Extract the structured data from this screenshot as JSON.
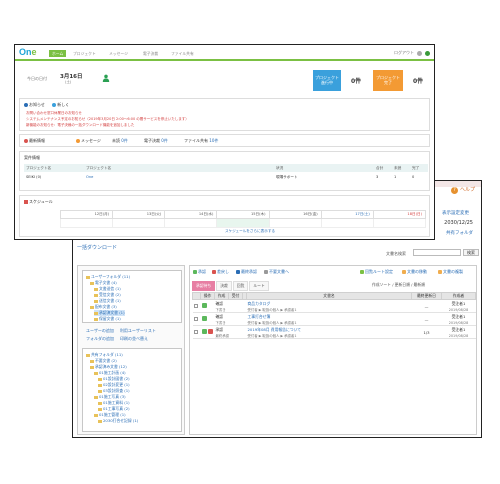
{
  "back_window": {
    "help": "ヘルプ",
    "right_link1": "表示設定変更",
    "right_date": "2030/12/25",
    "right_link2": "共有フォルダ",
    "title": "一括ダウンロード",
    "search_label": "文書名検索",
    "search_button": "検索",
    "tree": {
      "top_folders": [
        "ユーザーフォルダ (11)",
        "電子文書 (4)",
        "文書送信 (1)",
        "受信文書 (2)",
        "送信文書 (1)",
        "配布文書 (3)",
        "承認済文書 (1)",
        "保留文書 (1)"
      ],
      "links": [
        "ユーザーの追加",
        "利用ユーザーリスト",
        "フォルダの追加",
        "印刷の並べ替え"
      ],
      "bottom_folders": [
        "共有フォルダ (11)",
        "不要文書 (2)",
        "承認済み文書 (12)",
        "01施工計画 (4)",
        "01設計図書 (2)",
        "02設計変更 (1)",
        "03設計照査 (1)",
        "01施工写真 (3)",
        "01施工資料 (1)",
        "01工事写真 (2)",
        "01施工管理 (1)",
        "2030打合せ記録 (1)"
      ]
    },
    "toolbar": [
      "承認",
      "差戻し",
      "最終承認",
      "不要文書へ"
    ],
    "toolbar_right": [
      "回覧ルート設定",
      "文書の移動",
      "文書の複製"
    ],
    "pill_green": "承認",
    "pill_orange": "文書の作成",
    "tabs": [
      "承認待ち",
      "決裁",
      "回覧",
      "ルート"
    ],
    "sort_info": "作成ソート / 更新日順 / 最新順",
    "columns": [
      "",
      "操作",
      "作成",
      "受付",
      "",
      "文書名",
      "最終更新日",
      "作成者"
    ],
    "rows": [
      {
        "status": "確認",
        "sub": "下書き",
        "name": "商品カタログ",
        "info": "受付者 ▶ 取扱の個人 ▶ 承認者1",
        "date": "—",
        "author": "受注者1",
        "author2": "2019/08/28"
      },
      {
        "status": "確認",
        "sub": "下書き",
        "name": "工事打合せ簿",
        "info": "受付者 ▶ 取扱の個人 ▶ 承認者1",
        "date": "—",
        "author": "受注者1",
        "author2": "2019/08/28"
      },
      {
        "status": "承認",
        "sub": "最終承認",
        "name": "2019年08月 費用報告について",
        "info": "受付者 ▶ 取扱の個人 ▶ 承認者1",
        "date": "1/3",
        "author": "受注者1",
        "author2": "2019/08/28"
      }
    ]
  },
  "front_window": {
    "logo_main": "On",
    "logo_e": "e",
    "nav": [
      "ホーム",
      "プロジェクト",
      "メッセージ",
      "電子決裁",
      "ファイル共有"
    ],
    "nav_right": "ログアウト",
    "date_label": "今日の日付",
    "date_main": "3月16日",
    "date_dow": "(土)",
    "cards": [
      {
        "label1": "プロジェクト",
        "label2": "進行中",
        "count": "0件"
      },
      {
        "label1": "プロジェクト",
        "label2": "完了",
        "count": "0件"
      }
    ],
    "notice": {
      "title": "お知らせ",
      "new": "新しく",
      "lines": [
        "お問い合わせ窓口休業日のお知らせ",
        "システムメンテナンス予定のお知らせ（2019年3月20日 2:00〜6:00 の間サービスを停止いたします）",
        "新機能のお知らせ：電子決裁の一括ダウンロード機能を追加しました"
      ]
    },
    "flow": {
      "title": "最新情報",
      "items": [
        {
          "label": "メッセージ",
          "count": "0件"
        },
        {
          "label": "未読",
          "count": "0件"
        },
        {
          "label": "電子決裁",
          "count": "0件"
        },
        {
          "label": "ファイル共有",
          "count": "10件"
        }
      ]
    },
    "matters": {
      "title": "案件情報",
      "columns": [
        "プロジェクト名",
        "プロジェクト名",
        "状況",
        "合計",
        "未読",
        "完了"
      ],
      "rows": [
        {
          "c1": "SEIKI (0)",
          "c2": "One",
          "c3": "現場サポート",
          "c4": "3",
          "c5": "1",
          "c6": "0"
        }
      ]
    },
    "schedule": {
      "title": "スケジュール",
      "days": [
        "12日(月)",
        "13日(火)",
        "14日(水)",
        "15日(木)",
        "16日(金)",
        "17日(土)",
        "18日(日)"
      ],
      "link": "スケジュールをさらに表示する"
    }
  }
}
